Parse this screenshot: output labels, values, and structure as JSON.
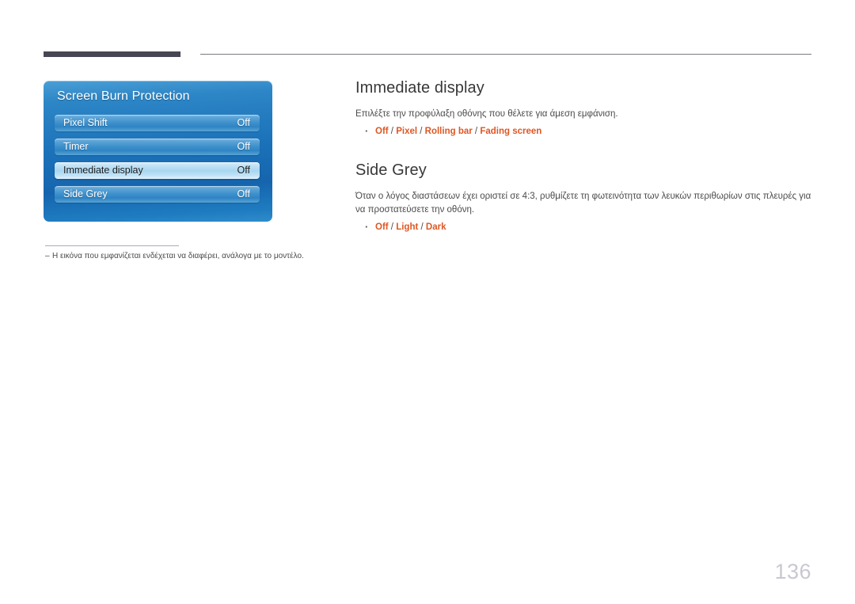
{
  "page": {
    "number": "136"
  },
  "osd": {
    "title": "Screen Burn Protection",
    "rows": [
      {
        "label": "Pixel Shift",
        "value": "Off",
        "selected": false
      },
      {
        "label": "Timer",
        "value": "Off",
        "selected": false
      },
      {
        "label": "Immediate display",
        "value": "Off",
        "selected": true
      },
      {
        "label": "Side Grey",
        "value": "Off",
        "selected": false
      }
    ]
  },
  "footnote": {
    "dash": "–",
    "text": "Η εικόνα που εμφανίζεται ενδέχεται να διαφέρει, ανάλογα με το μοντέλο."
  },
  "content": {
    "sections": [
      {
        "heading": "Immediate display",
        "description": "Επιλέξτε την προφύλαξη οθόνης που θέλετε για άμεση εμφάνιση.",
        "options": [
          "Off",
          "Pixel",
          "Rolling bar",
          "Fading screen"
        ],
        "options_text": "Off / Pixel / Rolling bar / Fading screen"
      },
      {
        "heading": "Side Grey",
        "description": "Όταν ο λόγος διαστάσεων έχει οριστεί σε 4:3, ρυθμίζετε τη φωτεινότητα των λευκών περιθωρίων στις πλευρές για να προστατεύσετε την οθόνη.",
        "options": [
          "Off",
          "Light",
          "Dark"
        ],
        "options_text": "Off / Light / Dark"
      }
    ]
  },
  "colors": {
    "accent_orange": "#de5723",
    "header_bar": "#474654",
    "panel_blue": "#1c73ba",
    "page_number": "#c8c8d2"
  }
}
